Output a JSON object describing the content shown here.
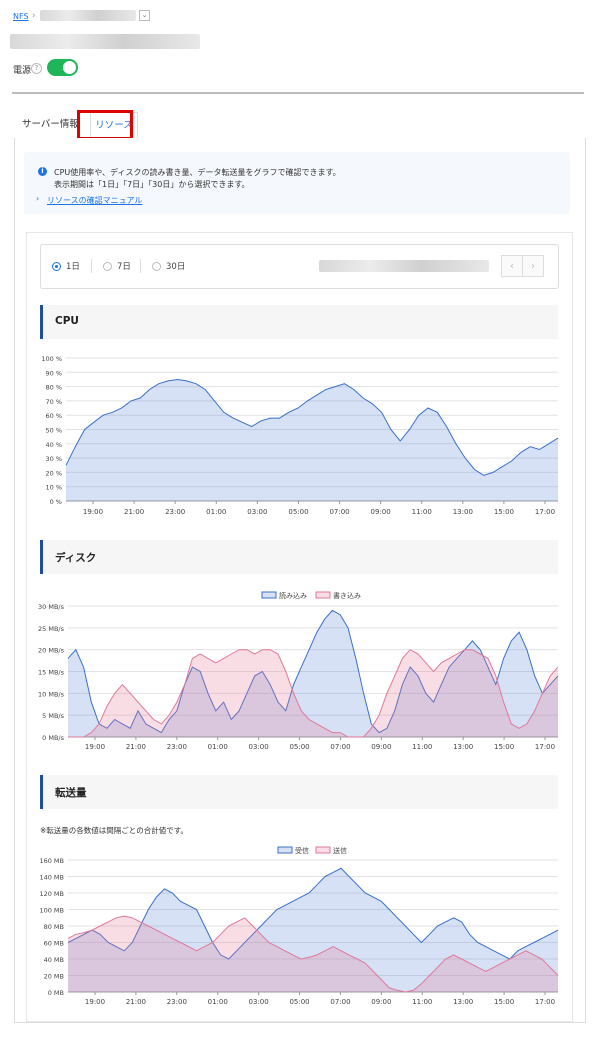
{
  "breadcrumb": {
    "root": "NFS"
  },
  "power": {
    "label": "電源",
    "help": "?",
    "state": "on"
  },
  "tabs": [
    {
      "label": "サーバー情報",
      "active": false
    },
    {
      "label": "リソース",
      "active": true
    }
  ],
  "info": {
    "line1": "CPU使用率や、ディスクの読み書き量、データ転送量をグラフで確認できます。",
    "line2": "表示期間は「1日」「7日」「30日」から選択できます。",
    "manual_link": "リソースの確認マニュアル"
  },
  "range": {
    "options": [
      {
        "label": "1日",
        "selected": true
      },
      {
        "label": "7日",
        "selected": false
      },
      {
        "label": "30日",
        "selected": false
      }
    ],
    "prev": "‹",
    "next": "›"
  },
  "sections": {
    "cpu": "CPU",
    "disk": "ディスク",
    "transfer": "転送量",
    "transfer_note": "※転送量の各数値は間隔ごとの合計値です。"
  },
  "colors": {
    "accent": "#1a73e8",
    "series_a": "#3a6fc9",
    "series_b": "#e0789a",
    "toggle": "#1fb559",
    "highlight_box": "#e00000"
  },
  "chart_data": [
    {
      "id": "cpu",
      "type": "area",
      "xticks": [
        "19:00",
        "21:00",
        "23:00",
        "01:00",
        "03:00",
        "05:00",
        "07:00",
        "09:00",
        "11:00",
        "13:00",
        "15:00",
        "17:00"
      ],
      "yticks": [
        "100 %",
        "90 %",
        "80 %",
        "70 %",
        "60 %",
        "50 %",
        "40 %",
        "30 %",
        "20 %",
        "10 %",
        "0 %"
      ],
      "ylim": [
        0,
        100
      ],
      "series": [
        {
          "values": [
            25,
            38,
            50,
            55,
            60,
            62,
            65,
            70,
            72,
            78,
            82,
            84,
            85,
            84,
            82,
            78,
            70,
            62,
            58,
            55,
            52,
            56,
            58,
            58,
            62,
            65,
            70,
            74,
            78,
            80,
            82,
            78,
            72,
            68,
            62,
            50,
            42,
            50,
            60,
            65,
            62,
            52,
            40,
            30,
            22,
            18,
            20,
            24,
            28,
            34,
            38,
            36,
            40,
            44
          ]
        }
      ]
    },
    {
      "id": "disk",
      "type": "area",
      "xticks": [
        "19:00",
        "21:00",
        "23:00",
        "01:00",
        "03:00",
        "05:00",
        "07:00",
        "09:00",
        "11:00",
        "13:00",
        "15:00",
        "17:00"
      ],
      "yticks": [
        "30 MB/s",
        "25 MB/s",
        "20 MB/s",
        "15 MB/s",
        "10 MB/s",
        "5 MB/s",
        "0 MB/s"
      ],
      "ylim": [
        0,
        30
      ],
      "legend": [
        "読み込み",
        "書き込み"
      ],
      "series": [
        {
          "name": "読み込み",
          "values": [
            18,
            20,
            16,
            8,
            3,
            2,
            4,
            3,
            2,
            6,
            3,
            2,
            1,
            4,
            6,
            12,
            16,
            15,
            10,
            6,
            8,
            4,
            6,
            10,
            14,
            15,
            12,
            8,
            6,
            12,
            16,
            20,
            24,
            27,
            29,
            28,
            25,
            18,
            10,
            3,
            1,
            2,
            6,
            12,
            16,
            14,
            10,
            8,
            12,
            16,
            18,
            20,
            22,
            20,
            16,
            12,
            18,
            22,
            24,
            20,
            14,
            10,
            12,
            14
          ]
        },
        {
          "name": "書き込み",
          "values": [
            0,
            0,
            0,
            1,
            3,
            7,
            10,
            12,
            10,
            8,
            6,
            4,
            3,
            5,
            8,
            12,
            18,
            19,
            18,
            17,
            18,
            19,
            20,
            20,
            19,
            20,
            20,
            19,
            15,
            10,
            6,
            4,
            3,
            2,
            1,
            1,
            0,
            0,
            0,
            2,
            5,
            10,
            14,
            18,
            20,
            19,
            17,
            15,
            17,
            18,
            19,
            20,
            20,
            19,
            18,
            14,
            8,
            3,
            2,
            3,
            6,
            10,
            14,
            16
          ]
        }
      ]
    },
    {
      "id": "transfer",
      "type": "area",
      "xticks": [
        "19:00",
        "21:00",
        "23:00",
        "01:00",
        "03:00",
        "05:00",
        "07:00",
        "09:00",
        "11:00",
        "13:00",
        "15:00",
        "17:00"
      ],
      "yticks": [
        "160 MB",
        "140 MB",
        "120 MB",
        "100 MB",
        "80 MB",
        "60 MB",
        "40 MB",
        "20 MB",
        "0 MB"
      ],
      "ylim": [
        0,
        160
      ],
      "legend": [
        "受信",
        "送信"
      ],
      "series": [
        {
          "name": "受信",
          "values": [
            60,
            65,
            70,
            75,
            70,
            60,
            55,
            50,
            60,
            80,
            100,
            115,
            125,
            120,
            110,
            105,
            100,
            80,
            60,
            45,
            40,
            50,
            60,
            70,
            80,
            90,
            100,
            105,
            110,
            115,
            120,
            130,
            140,
            145,
            150,
            140,
            130,
            120,
            115,
            110,
            100,
            90,
            80,
            70,
            60,
            70,
            80,
            85,
            90,
            85,
            70,
            60,
            55,
            50,
            45,
            40,
            50,
            55,
            60,
            65,
            70,
            75
          ]
        },
        {
          "name": "送信",
          "values": [
            65,
            70,
            72,
            75,
            80,
            85,
            90,
            92,
            90,
            85,
            80,
            75,
            70,
            65,
            60,
            55,
            50,
            55,
            60,
            70,
            80,
            85,
            90,
            80,
            70,
            60,
            55,
            50,
            45,
            40,
            42,
            45,
            50,
            55,
            50,
            45,
            40,
            35,
            25,
            15,
            5,
            2,
            0,
            2,
            10,
            20,
            30,
            40,
            45,
            40,
            35,
            30,
            25,
            30,
            35,
            40,
            45,
            50,
            45,
            40,
            30,
            20
          ]
        }
      ]
    }
  ]
}
